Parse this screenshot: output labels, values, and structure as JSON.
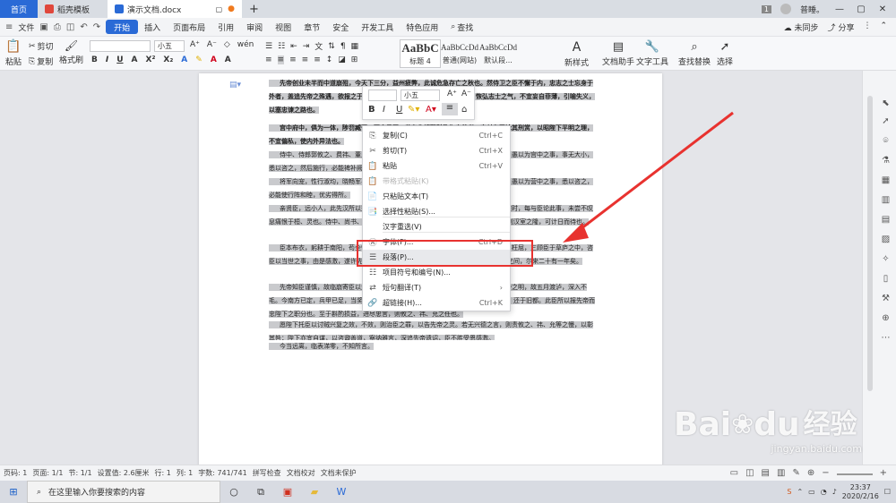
{
  "tabs": {
    "home": "首页",
    "straw": "稻壳模板",
    "doc": "演示文档.docx",
    "count": "1",
    "user": "普睡。"
  },
  "menubar": {
    "file": "文件",
    "items": [
      "开始",
      "插入",
      "页面布局",
      "引用",
      "审阅",
      "视图",
      "章节",
      "安全",
      "开发工具",
      "特色应用"
    ],
    "search": "查找",
    "right": [
      "未同步",
      "分享"
    ]
  },
  "ribbon": {
    "paste": "粘贴",
    "cut": "剪切",
    "copy": "复制",
    "format_painter": "格式刷",
    "font_size": "小五",
    "styles": [
      {
        "preview": "AaBbC",
        "name": "标题 4"
      },
      {
        "preview": "AaBbCcDd",
        "name": "普通(网站)"
      },
      {
        "preview": "AaBbCcDd",
        "name": "默认段..."
      }
    ],
    "new_style": "新样式",
    "doc_helper": "文档助手",
    "text_tool": "文字工具",
    "find_replace": "查找替换",
    "select": "选择"
  },
  "document": {
    "paragraphs": [
      "先帝创业未半而中道崩殂，今天下三分，益州疲弊，此诚危急存亡之秋也。然侍卫之臣不懈于内，忠志之士忘身于外者，盖追先帝之殊遇，欲报之于陛下也。诚宜开张圣听，以光先帝遗德，恢弘志士之气，不宜妄自菲薄，引喻失义，以塞忠谏之路也。",
      "宫中府中，俱为一体，陟罚臧否，不宜异同。若有作奸犯科及为忠善者，宜付有司论其刑赏，以昭陛下平明之理，不宜偏私，使内外异法也。",
      "侍中、侍郎郭攸之、费祎、董允等，此皆良实，志虑忠纯，是以先帝简拔以遗陛下。愚以为宫中之事，事无大小，悉以咨之，然后施行，必能裨补阙漏，有所广益。",
      "将军向宠，性行淑均，晓畅军事，试用于昔日，先帝称之曰能，是以众议举宠为督。愚以为营中之事，悉以咨之，必能使行阵和睦，优劣得所。",
      "亲贤臣，远小人，此先汉所以兴隆也；亲小人，远贤臣，此后汉所以倾颓也。先帝在时，每与臣论此事，未尝不叹息痛恨于桓、灵也。侍中、尚书、长史、参军，此悉贞良死节之臣，愿陛下亲之信之，则汉室之隆，可计日而待也。",
      "臣本布衣，躬耕于南阳，苟全性命于乱世，不求闻达于诸侯。先帝不以臣卑鄙，猥自枉屈，三顾臣于草庐之中，咨臣以当世之事，由是感激，遂许先帝以驱驰。后值倾覆，受任于败军之际，奉命于危难之间，尔来二十有一年矣。",
      "先帝知臣谨慎，故临崩寄臣以大事也。受命以来，夙夜忧叹，恐托付不效，以伤先帝之明，故五月渡泸，深入不毛。今南方已定，兵甲已足，当奖率三军，北定中原，庶竭驽钝，攘除奸凶，兴复汉室，还于旧都。此臣所以报先帝而忠陛下之职分也。至于斟酌损益，进尽忠言，则攸之、祎、允之任也。",
      "愿陛下托臣以讨贼兴复之效，不效，则治臣之罪，以告先帝之灵。若无兴德之言，则责攸之、祎、允等之慢，以彰其咎；陛下亦宜自谋，以咨诹善道，察纳雅言，深追先帝遗诏，臣不胜受恩感激。",
      "今当远离，临表涕零，不知所言。"
    ]
  },
  "minitoolbar": {
    "font_size": "小五",
    "bold": "B",
    "italic": "I",
    "underline": "U"
  },
  "context_menu": {
    "items": [
      {
        "icon": "copy-icon",
        "label": "复制(C)",
        "shortcut": "Ctrl+C",
        "enabled": true
      },
      {
        "icon": "cut-icon",
        "label": "剪切(T)",
        "shortcut": "Ctrl+X",
        "enabled": true
      },
      {
        "icon": "paste-icon",
        "label": "粘贴",
        "shortcut": "Ctrl+V",
        "enabled": true
      },
      {
        "icon": "paste-format-icon",
        "label": "带格式粘贴(K)",
        "shortcut": "",
        "enabled": false
      },
      {
        "icon": "paste-text-icon",
        "label": "只粘贴文本(T)",
        "shortcut": "",
        "enabled": true
      },
      {
        "icon": "paste-special-icon",
        "label": "选择性粘贴(S)...",
        "shortcut": "",
        "enabled": true
      },
      {
        "icon": "",
        "label": "汉字重选(V)",
        "shortcut": "",
        "enabled": true
      },
      {
        "icon": "font-icon",
        "label": "字体(F)...",
        "shortcut": "Ctrl+D",
        "enabled": true
      },
      {
        "icon": "paragraph-icon",
        "label": "段落(P)...",
        "shortcut": "",
        "enabled": true
      },
      {
        "icon": "list-icon",
        "label": "项目符号和编号(N)...",
        "shortcut": "",
        "enabled": true
      },
      {
        "icon": "translate-icon",
        "label": "短句翻译(T)",
        "shortcut": "›",
        "enabled": true
      },
      {
        "icon": "link-icon",
        "label": "超链接(H)...",
        "shortcut": "Ctrl+K",
        "enabled": true
      }
    ]
  },
  "statusbar": {
    "items": [
      "页码: 1",
      "页面: 1/1",
      "节: 1/1",
      "设置值: 2.6厘米",
      "行: 1",
      "列: 1",
      "字数: 741/741",
      "拼写检查",
      "文档校对",
      "文档未保护"
    ]
  },
  "taskbar": {
    "search_placeholder": "在这里输入你要搜索的内容",
    "time": "23:37",
    "date": "2020/2/16"
  },
  "watermark": {
    "brand": "Bai",
    "brand2": "du",
    "cn": "经验",
    "url": "jingyan.baidu.com"
  },
  "colors": {
    "accent": "#2a6ad6",
    "annotation_red": "#e8322f",
    "selection_gray": "#c9cacd"
  }
}
